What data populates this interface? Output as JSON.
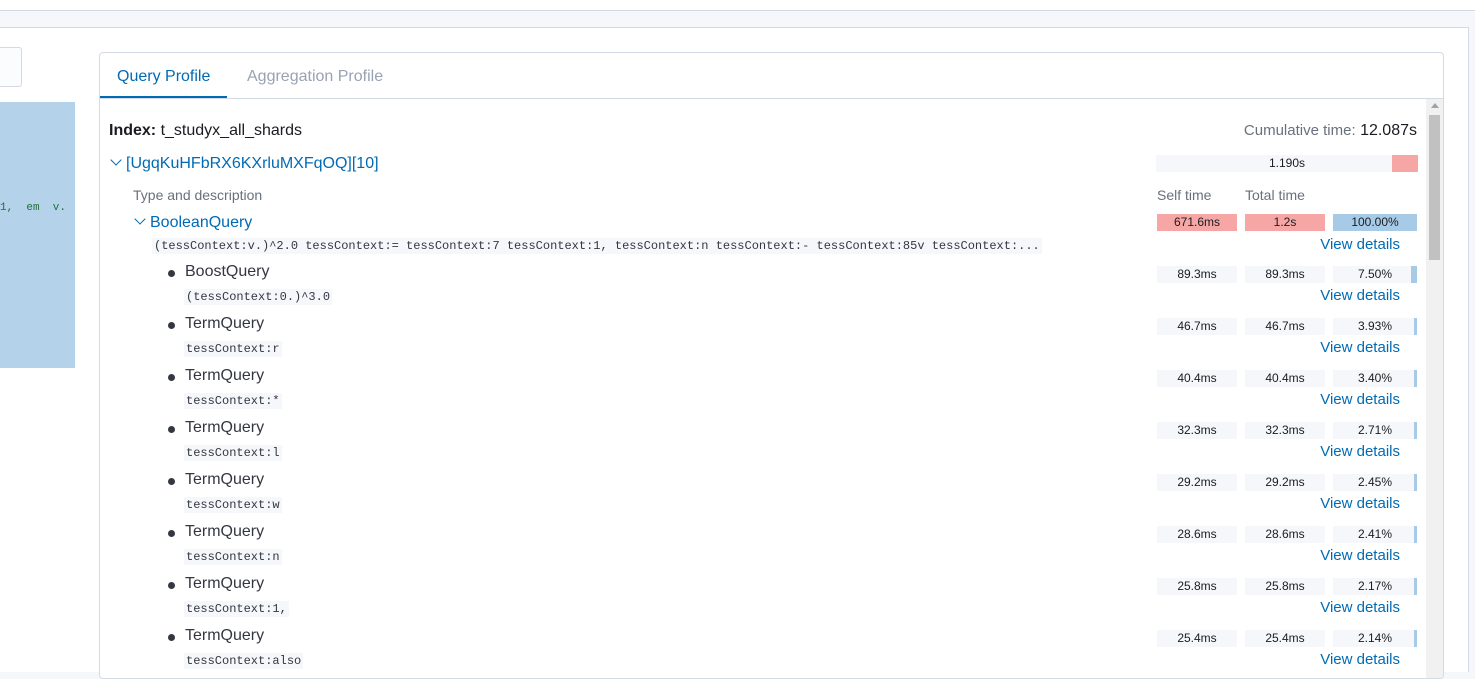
{
  "left_editor_text": "1,  em  v.",
  "tabs": [
    "Query Profile",
    "Aggregation Profile"
  ],
  "index": {
    "label": "Index:",
    "name": "t_studyx_all_shards"
  },
  "cumulative": {
    "label": "Cumulative time:",
    "value": "12.087s"
  },
  "shard": {
    "label": "[UgqKuHFbRX6KXrluMXFqOQ][10]",
    "time": "1.190s"
  },
  "headers": {
    "type": "Type and description",
    "self": "Self time",
    "total": "Total time"
  },
  "root": {
    "name": "BooleanQuery",
    "desc": "(tessContext:v.)^2.0 tessContext:= tessContext:7 tessContext:1, tessContext:n tessContext:- tessContext:85v tessContext:...",
    "self": "671.6ms",
    "total": "1.2s",
    "pct": "100.00%",
    "pct_value": 100,
    "view": "View details"
  },
  "children": [
    {
      "name": "BoostQuery",
      "desc": "(tessContext:0.)^3.0",
      "self": "89.3ms",
      "total": "89.3ms",
      "pct": "7.50%",
      "pct_value": 7.5,
      "view": "View details"
    },
    {
      "name": "TermQuery",
      "desc": "tessContext:r",
      "self": "46.7ms",
      "total": "46.7ms",
      "pct": "3.93%",
      "pct_value": 3.93,
      "view": "View details"
    },
    {
      "name": "TermQuery",
      "desc": "tessContext:*",
      "self": "40.4ms",
      "total": "40.4ms",
      "pct": "3.40%",
      "pct_value": 3.4,
      "view": "View details"
    },
    {
      "name": "TermQuery",
      "desc": "tessContext:l",
      "self": "32.3ms",
      "total": "32.3ms",
      "pct": "2.71%",
      "pct_value": 2.71,
      "view": "View details"
    },
    {
      "name": "TermQuery",
      "desc": "tessContext:w",
      "self": "29.2ms",
      "total": "29.2ms",
      "pct": "2.45%",
      "pct_value": 2.45,
      "view": "View details"
    },
    {
      "name": "TermQuery",
      "desc": "tessContext:n",
      "self": "28.6ms",
      "total": "28.6ms",
      "pct": "2.41%",
      "pct_value": 2.41,
      "view": "View details"
    },
    {
      "name": "TermQuery",
      "desc": "tessContext:1,",
      "self": "25.8ms",
      "total": "25.8ms",
      "pct": "2.17%",
      "pct_value": 2.17,
      "view": "View details"
    },
    {
      "name": "TermQuery",
      "desc": "tessContext:also",
      "self": "25.4ms",
      "total": "25.4ms",
      "pct": "2.14%",
      "pct_value": 2.14,
      "view": "View details"
    }
  ]
}
